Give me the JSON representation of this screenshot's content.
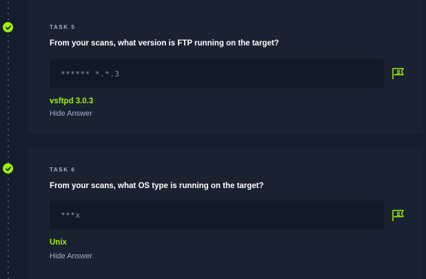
{
  "tasks": [
    {
      "label": "TASK 5",
      "question": "From your scans, what version is FTP running on the target?",
      "answer_mask": "****** *.*.3",
      "answer": "vsftpd 3.0.3",
      "hide_label": "Hide Answer",
      "completed": true
    },
    {
      "label": "TASK 6",
      "question": "From your scans, what OS type is running on the target?",
      "answer_mask": "***x",
      "answer": "Unix",
      "hide_label": "Hide Answer",
      "completed": true
    }
  ],
  "colors": {
    "accent": "#9fef00",
    "background": "#151c2b",
    "card": "#1a2232",
    "input": "#111927"
  },
  "icons": {
    "status": "check-icon",
    "submit": "flag-icon"
  }
}
